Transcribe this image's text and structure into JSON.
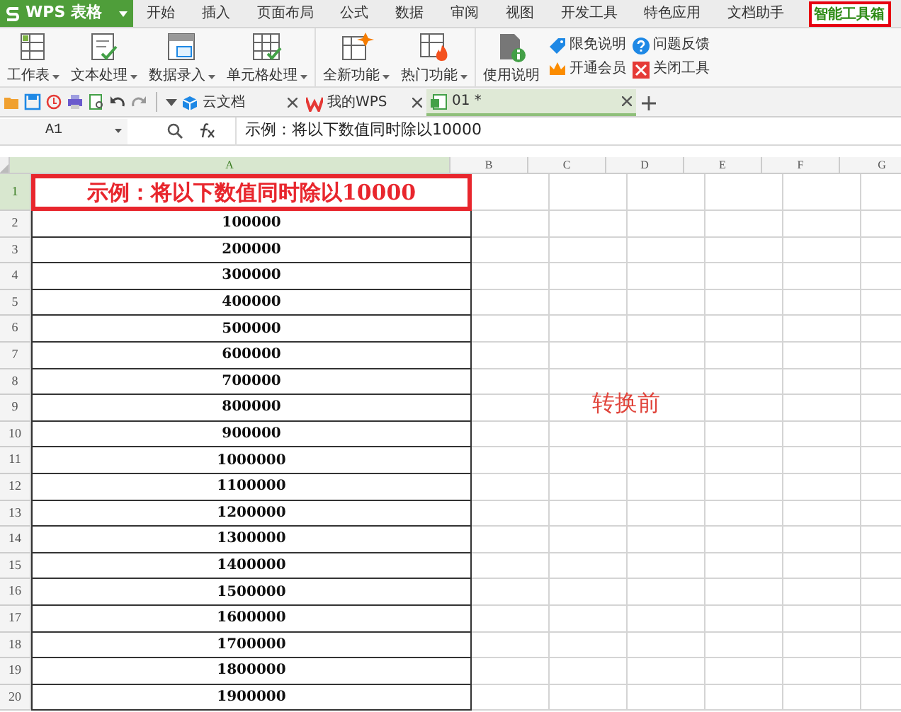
{
  "brand": "WPS 表格",
  "menu_tabs": [
    {
      "label": "开始",
      "selected": false
    },
    {
      "label": "插入",
      "selected": false
    },
    {
      "label": "页面布局",
      "selected": false
    },
    {
      "label": "公式",
      "selected": false
    },
    {
      "label": "数据",
      "selected": false
    },
    {
      "label": "审阅",
      "selected": false
    },
    {
      "label": "视图",
      "selected": false
    },
    {
      "label": "开发工具",
      "selected": false
    },
    {
      "label": "特色应用",
      "selected": false
    },
    {
      "label": "文档助手",
      "selected": false
    },
    {
      "label": "智能工具箱",
      "selected": true
    }
  ],
  "ribbon_groups": [
    {
      "large_buttons": [
        {
          "label": "工作表",
          "dropdown": true
        },
        {
          "label": "文本处理",
          "dropdown": true
        },
        {
          "label": "数据录入",
          "dropdown": true
        },
        {
          "label": "单元格处理",
          "dropdown": true
        }
      ]
    },
    {
      "large_buttons": [
        {
          "label": "全新功能",
          "dropdown": true
        },
        {
          "label": "热门功能",
          "dropdown": true
        }
      ]
    },
    {
      "large_buttons": [
        {
          "label": "使用说明",
          "dropdown": false
        }
      ],
      "small_buttons": [
        {
          "label": "限免说明"
        },
        {
          "label": "问题反馈"
        },
        {
          "label": "开通会员"
        },
        {
          "label": "关闭工具"
        }
      ]
    }
  ],
  "doc_tabs": [
    {
      "label": "云文档",
      "selected": false
    },
    {
      "label": "我的WPS",
      "selected": false
    },
    {
      "label": "01 *",
      "selected": true
    }
  ],
  "name_box": "A1",
  "formula": "示例：将以下数值同时除以10000",
  "columns": [
    {
      "label": "A",
      "selected": true
    },
    {
      "label": "B",
      "selected": false
    },
    {
      "label": "C",
      "selected": false
    },
    {
      "label": "D",
      "selected": false
    },
    {
      "label": "E",
      "selected": false
    },
    {
      "label": "F",
      "selected": false
    },
    {
      "label": "G",
      "selected": false
    }
  ],
  "rows": [
    {
      "number": "1",
      "value": "示例：将以下数值同时除以10000",
      "kind": "title"
    },
    {
      "number": "2",
      "value": "100000",
      "kind": "data"
    },
    {
      "number": "3",
      "value": "200000",
      "kind": "data"
    },
    {
      "number": "4",
      "value": "300000",
      "kind": "data"
    },
    {
      "number": "5",
      "value": "400000",
      "kind": "data"
    },
    {
      "number": "6",
      "value": "500000",
      "kind": "data"
    },
    {
      "number": "7",
      "value": "600000",
      "kind": "data"
    },
    {
      "number": "8",
      "value": "700000",
      "kind": "data"
    },
    {
      "number": "9",
      "value": "800000",
      "kind": "data"
    },
    {
      "number": "10",
      "value": "900000",
      "kind": "data"
    },
    {
      "number": "11",
      "value": "1000000",
      "kind": "data"
    },
    {
      "number": "12",
      "value": "1100000",
      "kind": "data"
    },
    {
      "number": "13",
      "value": "1200000",
      "kind": "data"
    },
    {
      "number": "14",
      "value": "1300000",
      "kind": "data"
    },
    {
      "number": "15",
      "value": "1400000",
      "kind": "data"
    },
    {
      "number": "16",
      "value": "1500000",
      "kind": "data"
    },
    {
      "number": "17",
      "value": "1600000",
      "kind": "data"
    },
    {
      "number": "18",
      "value": "1700000",
      "kind": "data"
    },
    {
      "number": "19",
      "value": "1800000",
      "kind": "data"
    },
    {
      "number": "20",
      "value": "1900000",
      "kind": "data"
    }
  ],
  "annotation": "转换前"
}
